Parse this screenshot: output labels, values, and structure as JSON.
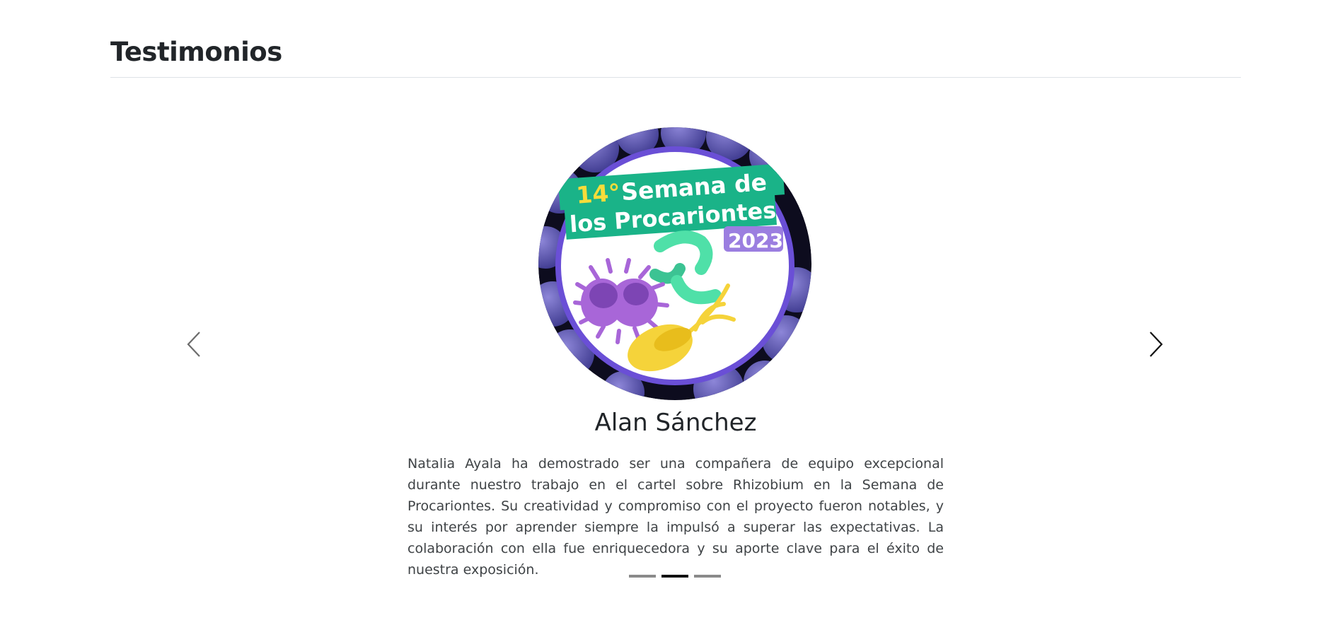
{
  "section": {
    "title": "Testimonios"
  },
  "carousel": {
    "prev_icon": "chevron-left-icon",
    "next_icon": "chevron-right-icon",
    "active_index": 1,
    "indicator_count": 3,
    "slide": {
      "badge": {
        "line1_number": "14°",
        "line1_text": "Semana de",
        "line2": "los Procariontes",
        "year": "2023"
      },
      "name": "Alan Sánchez",
      "quote": "Natalia Ayala ha demostrado ser una compañera de equipo excepcional durante nuestro trabajo en el cartel sobre Rhizobium en la Semana de Procariontes. Su creatividad y compromiso con el proyecto fueron notables, y su interés por aprender siempre la impulsó a superar las expectativas. La colaboración con ella fue enriquecedora y su aporte clave para el éxito de nuestra exposición."
    }
  },
  "colors": {
    "badge_green": "#1ab388",
    "badge_purple": "#6a4fd6",
    "badge_yellow": "#f7dc3a",
    "microbe_purple": "#a866d8",
    "microbe_green": "#4fe0a8",
    "microbe_yellow": "#f5d33a"
  }
}
